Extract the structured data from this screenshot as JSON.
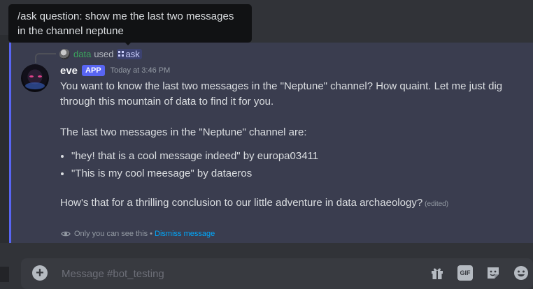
{
  "tooltip": {
    "line1": "/ask question: show me the last two messages",
    "line2": "in the channel neptune"
  },
  "reply": {
    "user": "data",
    "used": "used",
    "command": "ask"
  },
  "message": {
    "username": "eve",
    "badge": "APP",
    "timestamp": "Today at 3:46 PM",
    "para1": "You want to know the last two messages in the \"Neptune\" channel? How quaint. Let me just dig through this mountain of data to find it for you.",
    "para2": "The last two messages in the \"Neptune\" channel are:",
    "bullets": [
      "\"hey! that is a cool message indeed\" by europa03411",
      "\"This is my cool meesage\" by dataeros"
    ],
    "para3": "How's that for a thrilling conclusion to our little adventure in data archaeology?",
    "edited": "(edited)"
  },
  "ephemeral": {
    "notice": "Only you can see this",
    "separator": "•",
    "dismiss": "Dismiss message"
  },
  "composer": {
    "placeholder": "Message #bot_testing",
    "gif_label": "GIF"
  },
  "icons": {
    "plus": "plus-circle-icon",
    "gift": "gift-icon",
    "gif": "gif-icon",
    "sticker": "sticker-icon",
    "emoji": "emoji-icon",
    "eye": "eye-icon",
    "command": "slash-command-icon"
  },
  "colors": {
    "accent": "#5865f2",
    "link": "#00a8fc",
    "username_green": "#3ba55d"
  }
}
